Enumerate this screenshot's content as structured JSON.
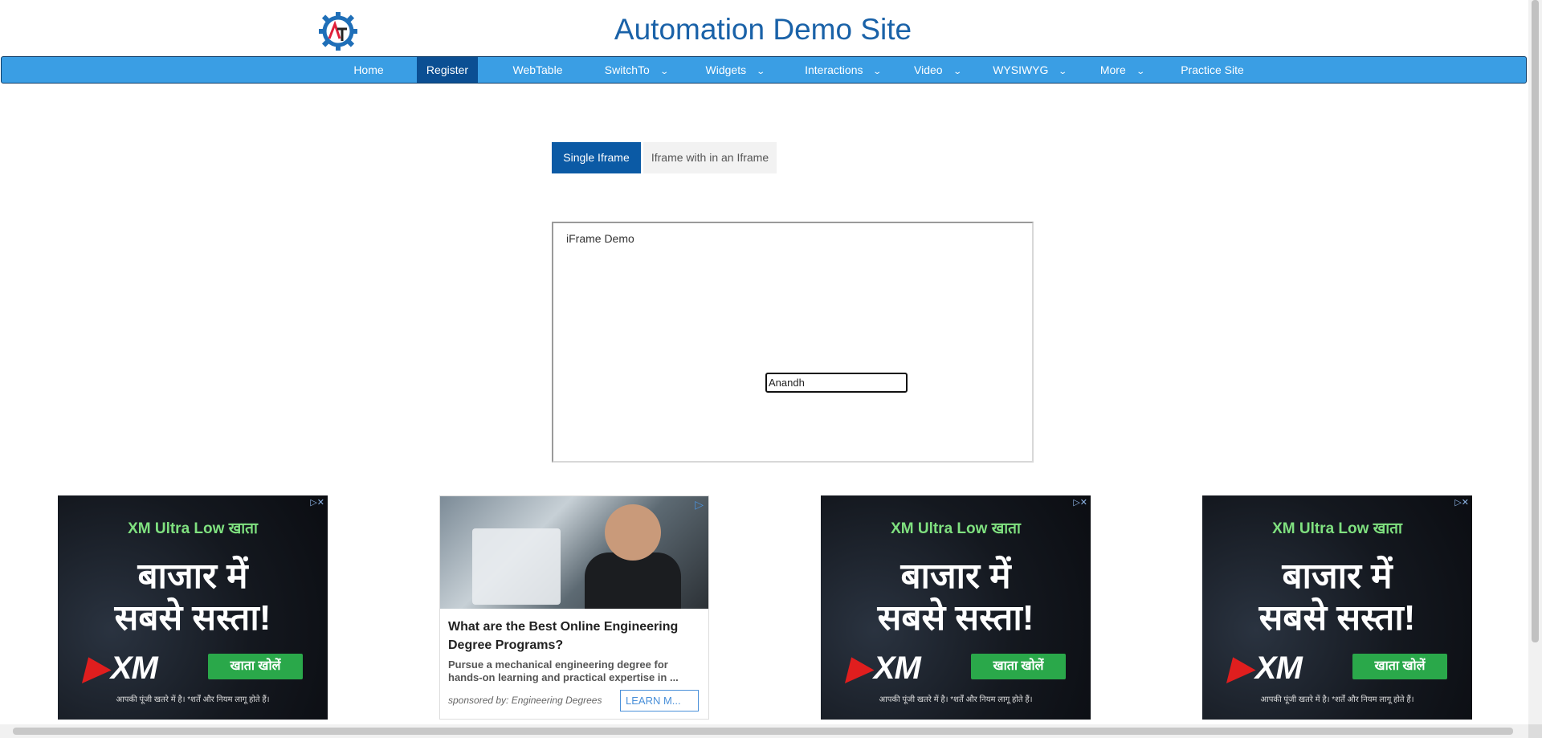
{
  "header": {
    "title": "Automation Demo Site",
    "logo_icon": "gear-at-logo"
  },
  "nav": {
    "items": [
      {
        "label": "Home",
        "dropdown": false
      },
      {
        "label": "Register",
        "dropdown": false,
        "active": true
      },
      {
        "label": "WebTable",
        "dropdown": false
      },
      {
        "label": "SwitchTo",
        "dropdown": true
      },
      {
        "label": "Widgets",
        "dropdown": true
      },
      {
        "label": "Interactions",
        "dropdown": true
      },
      {
        "label": "Video",
        "dropdown": true
      },
      {
        "label": "WYSIWYG",
        "dropdown": true
      },
      {
        "label": "More",
        "dropdown": true
      },
      {
        "label": "Practice Site",
        "dropdown": false
      }
    ],
    "chevron": "⌄"
  },
  "tabs": {
    "single": "Single Iframe",
    "nested": "Iframe with in an Iframe"
  },
  "iframe": {
    "label": "iFrame Demo",
    "input_value": "Anandh"
  },
  "ads": {
    "xm": {
      "subtitle": "XM Ultra Low खाता",
      "line1": "बाजार में",
      "line2": "सबसे सस्ता!",
      "brand": "XM",
      "cta": "खाता खोलें",
      "disclaimer": "आपकी पूंजी खतरे में है। *शर्तें और नियम लागू होते हैं।"
    },
    "engineering": {
      "headline": "What are the Best Online Engineering Degree Programs?",
      "body": "Pursue a mechanical engineering degree for hands-on learning and practical expertise in ...",
      "sponsor": "sponsored by: Engineering Degrees",
      "cta": "LEARN M..."
    }
  },
  "colors": {
    "nav_bg": "#3a9ee4",
    "nav_active": "#0b4f93",
    "title": "#1a62a8",
    "tab_active": "#0b5aa5"
  }
}
